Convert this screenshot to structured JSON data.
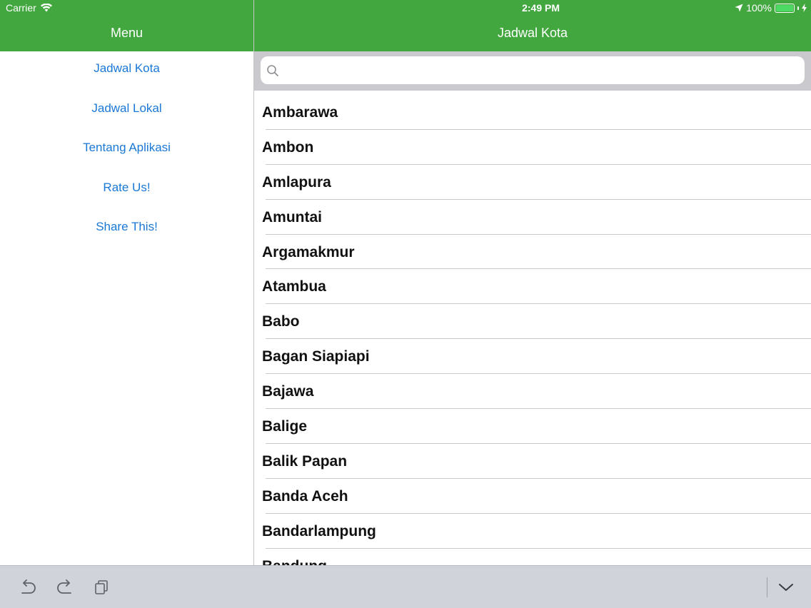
{
  "status_bar": {
    "carrier": "Carrier",
    "time": "2:49 PM",
    "battery": "100%",
    "battery_level_percent": 100
  },
  "master": {
    "title": "Menu",
    "items": [
      {
        "label": "Jadwal Kota"
      },
      {
        "label": "Jadwal Lokal"
      },
      {
        "label": "Tentang Aplikasi"
      },
      {
        "label": "Rate Us!"
      },
      {
        "label": "Share This!"
      }
    ]
  },
  "detail": {
    "title": "Jadwal Kota",
    "search": {
      "value": "",
      "placeholder": ""
    },
    "cities": [
      "Ambarawa",
      "Ambon",
      "Amlapura",
      "Amuntai",
      "Argamakmur",
      "Atambua",
      "Babo",
      "Bagan Siapiapi",
      "Bajawa",
      "Balige",
      "Balik Papan",
      "Banda Aceh",
      "Bandarlampung",
      "Bandung"
    ]
  },
  "colors": {
    "nav_green": "#43a740",
    "link_blue": "#1a78d6",
    "battery_green": "#4cd964"
  },
  "icons": {
    "wifi": "wifi-icon",
    "location": "location-arrow-icon",
    "charging": "bolt-icon",
    "search": "search-icon",
    "undo": "undo-icon",
    "redo": "redo-icon",
    "paste": "paste-icon",
    "hide_keyboard": "chevron-down-icon"
  }
}
